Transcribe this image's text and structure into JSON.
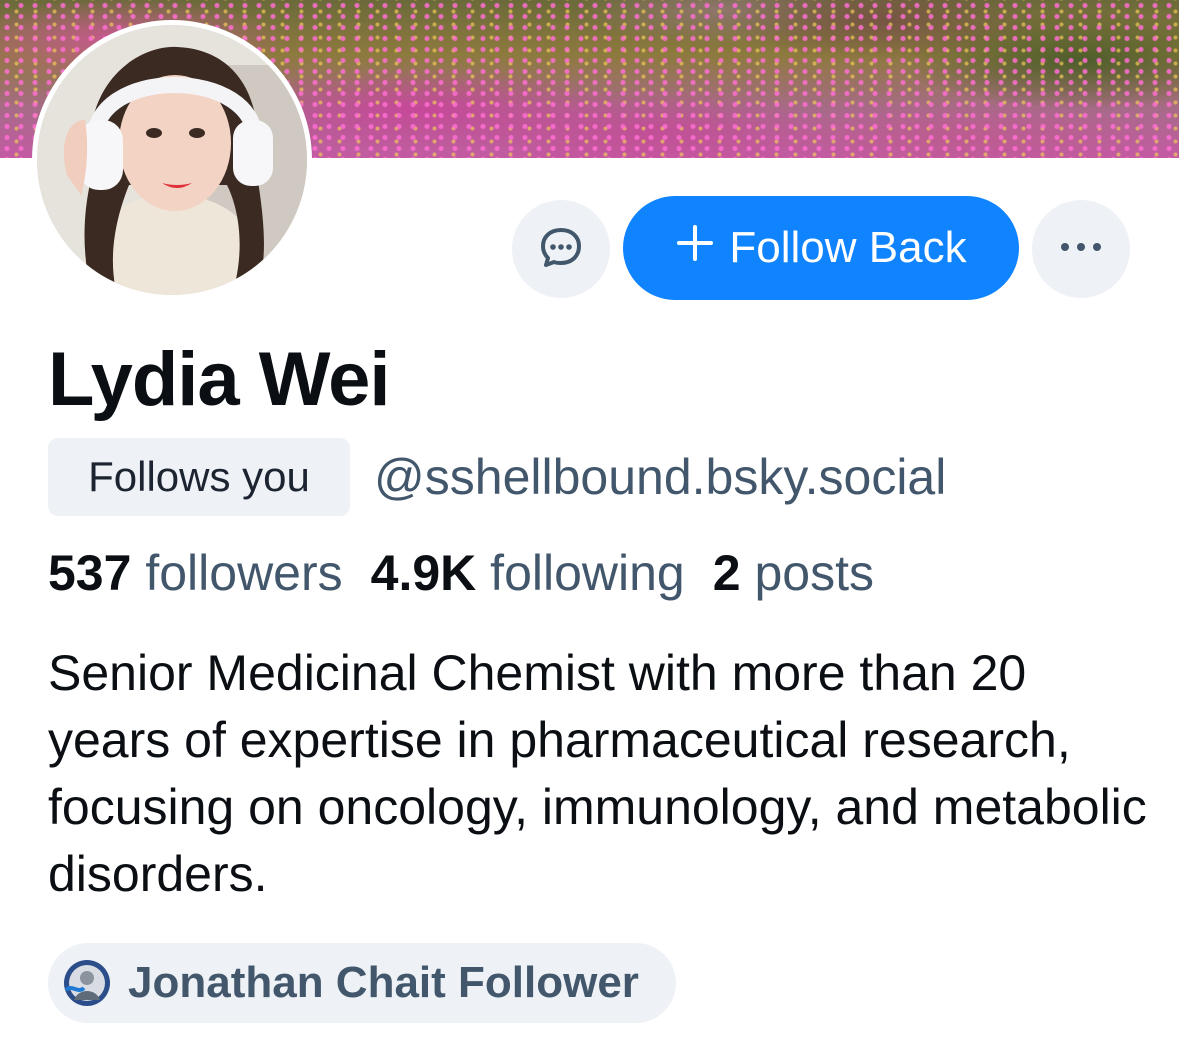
{
  "profile": {
    "display_name": "Lydia Wei",
    "follows_you_badge": "Follows you",
    "handle": "@sshellbound.bsky.social",
    "bio": "Senior Medicinal Chemist with more than 20 years of expertise in pharmaceutical research, focusing on oncology, immunology, and metabolic disorders."
  },
  "stats": {
    "followers_count": "537",
    "followers_label": "followers",
    "following_count": "4.9K",
    "following_label": "following",
    "posts_count": "2",
    "posts_label": "posts"
  },
  "actions": {
    "message_icon": "chat-bubble-icon",
    "follow_back_icon": "plus-icon",
    "follow_back_label": "Follow Back",
    "more_icon": "ellipsis-icon"
  },
  "known_followers": {
    "label": "Jonathan Chait Follower"
  },
  "colors": {
    "primary_button": "#1083fe",
    "secondary_text": "#42576c",
    "pill_background": "#eef1f5",
    "text": "#0b0f14"
  }
}
